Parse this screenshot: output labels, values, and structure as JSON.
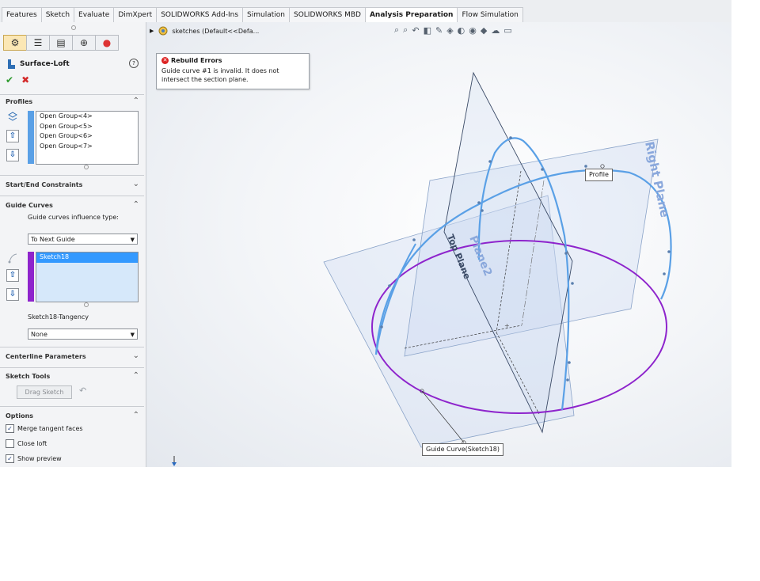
{
  "tabs": [
    "Features",
    "Sketch",
    "Evaluate",
    "DimXpert",
    "SOLIDWORKS Add-Ins",
    "Simulation",
    "SOLIDWORKS MBD",
    "Analysis Preparation",
    "Flow Simulation"
  ],
  "active_tab": "Analysis Preparation",
  "panel": {
    "feature_title": "Surface-Loft",
    "help_label": "?",
    "ok_label": "✔",
    "cancel_label": "✖",
    "profiles": {
      "header": "Profiles",
      "items": [
        "Open Group<4>",
        "Open Group<5>",
        "Open Group<6>",
        "Open Group<7>"
      ],
      "color": "#5aa0e6"
    },
    "start_end": {
      "header": "Start/End Constraints"
    },
    "guide_curves": {
      "header": "Guide Curves",
      "influence_label": "Guide curves influence type:",
      "influence_value": "To Next Guide",
      "items": [
        "Sketch18"
      ],
      "color": "#8e24cc",
      "tangency_label": "Sketch18-Tangency",
      "tangency_value": "None"
    },
    "centerline": {
      "header": "Centerline Parameters"
    },
    "sketch_tools": {
      "header": "Sketch Tools",
      "drag_sketch": "Drag Sketch"
    },
    "options": {
      "header": "Options",
      "merge_tangent": {
        "label": "Merge tangent faces",
        "checked": true
      },
      "close_loft": {
        "label": "Close loft",
        "checked": false
      },
      "show_preview": {
        "label": "Show preview",
        "checked": true
      }
    }
  },
  "viewport": {
    "tree_label": "sketches  (Default<<Defa...",
    "error": {
      "title": "Rebuild Errors",
      "message": "Guide curve #1 is invalid. It does not intersect the section plane."
    },
    "plane_labels": {
      "right": "Right Plane",
      "plane2": "Plane2",
      "top": "Top Plane"
    },
    "callouts": {
      "profile": "Profile",
      "guide": "Guide Curve(Sketch18)"
    },
    "colors": {
      "profile_curve": "#5aa0e6",
      "guide_curve": "#8e24cc",
      "plane_fill": "#c9d8f0",
      "plane_label": "#8aa8dc"
    }
  }
}
